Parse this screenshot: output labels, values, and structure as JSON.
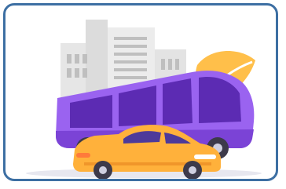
{
  "card": {
    "icon": "transport-illustration-icon",
    "colors": {
      "border": "#3d6fa3",
      "bus": "#9a63f0",
      "bus_shadow": "#7b43d6",
      "car": "#ffb13b",
      "building": "#e6e6e6",
      "leaf": "#ffbf4a"
    }
  }
}
